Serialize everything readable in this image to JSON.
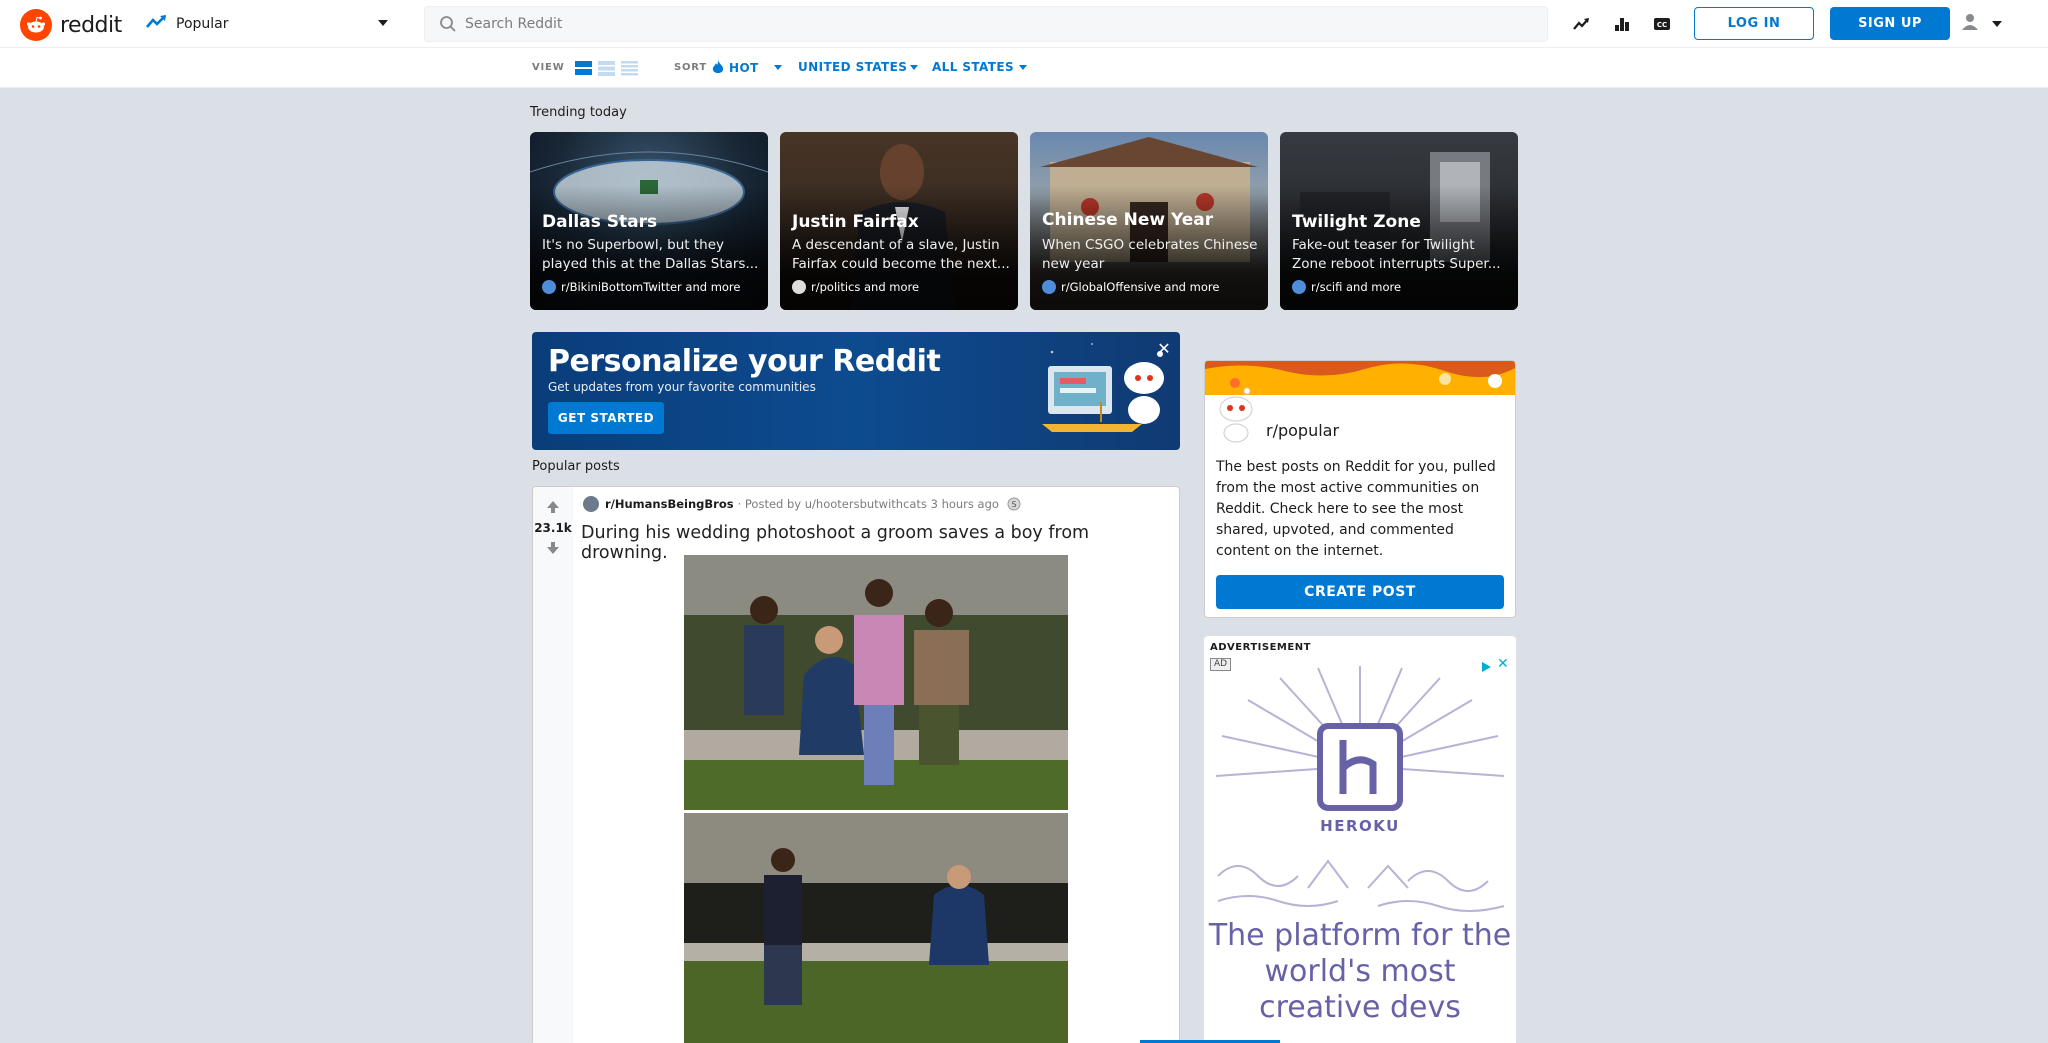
{
  "app": {
    "logo_text": "reddit"
  },
  "header": {
    "feed_label": "Popular",
    "search_placeholder": "Search Reddit",
    "login_label": "LOG IN",
    "signup_label": "SIGN UP",
    "icons": [
      "trending-icon",
      "stats-icon",
      "captions-icon",
      "user-icon",
      "chevron-down-icon"
    ]
  },
  "subheader": {
    "view_label": "VIEW",
    "sort_label": "SORT",
    "sort_value": "HOT",
    "region_value": "UNITED STATES",
    "states_value": "ALL STATES"
  },
  "trending": {
    "title": "Trending today",
    "cards": [
      {
        "title": "Dallas Stars",
        "desc": "It's no Superbowl, but they played this at the Dallas Stars...",
        "sub": "r/BikiniBottomTwitter and more"
      },
      {
        "title": "Justin Fairfax",
        "desc": "A descendant of a slave, Justin Fairfax could become the next...",
        "sub": "r/politics and more"
      },
      {
        "title": "Chinese New Year",
        "desc": "When CSGO celebrates Chinese new year",
        "sub": "r/GlobalOffensive and more"
      },
      {
        "title": "Twilight Zone",
        "desc": "Fake-out teaser for Twilight Zone reboot interrupts Super...",
        "sub": "r/scifi and more"
      }
    ]
  },
  "banner": {
    "title": "Personalize your Reddit",
    "subtitle": "Get updates from your favorite communities",
    "button": "GET STARTED"
  },
  "popular": {
    "title": "Popular posts",
    "post": {
      "score": "23.1k",
      "subreddit": "r/HumansBeingBros",
      "posted_by": "· Posted by u/hootersbutwithcats 3 hours ago",
      "title": "During his wedding photoshoot a groom saves a boy from drowning."
    }
  },
  "sidebar": {
    "name": "r/popular",
    "description": "The best posts on Reddit for you, pulled from the most active communities on Reddit. Check here to see the most shared, upvoted, and commented content on the internet.",
    "button": "CREATE POST"
  },
  "ad": {
    "label": "ADVERTISEMENT",
    "tag": "AD",
    "brand": "HEROKU",
    "text": "The platform for the world's most creative devs"
  },
  "colors": {
    "accent": "#0079d3",
    "brand": "#ff4500",
    "background": "#dae0e6"
  }
}
